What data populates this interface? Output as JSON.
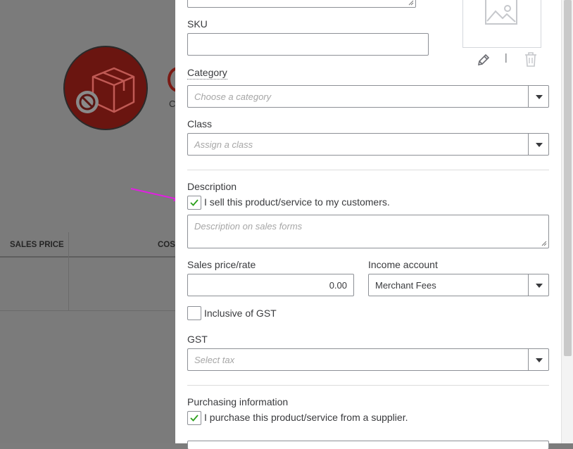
{
  "background": {
    "subtitle_fragment": "C",
    "table": {
      "col_sales_price": "SALES PRICE",
      "col_cost": "COS"
    }
  },
  "form": {
    "sku": {
      "label": "SKU",
      "value": ""
    },
    "category": {
      "label": "Category",
      "placeholder": "Choose a category"
    },
    "class": {
      "label": "Class",
      "placeholder": "Assign a class"
    },
    "description": {
      "label": "Description",
      "sell_checkbox_label": "I sell this product/service to my customers.",
      "sell_checked": true,
      "placeholder": "Description on sales forms"
    },
    "sales_price": {
      "label": "Sales price/rate",
      "value": "0.00"
    },
    "income_account": {
      "label": "Income account",
      "value": "Merchant Fees"
    },
    "inclusive_gst": {
      "label": "Inclusive of GST",
      "checked": false
    },
    "gst": {
      "label": "GST",
      "placeholder": "Select tax"
    },
    "purchasing": {
      "label": "Purchasing information",
      "purchase_checkbox_label": "I purchase this product/service from a supplier.",
      "purchase_checked": true
    },
    "image_actions": {
      "separator": "|"
    }
  },
  "colors": {
    "check_green": "#2ca01c",
    "annotation_arrow": "#e020e0",
    "overlay": "#7b7b7b"
  },
  "icons": [
    "image-placeholder-icon",
    "pencil-icon",
    "trash-icon",
    "caret-down-icon",
    "checkmark-icon",
    "resize-grip-icon",
    "box-blocked-icon"
  ]
}
